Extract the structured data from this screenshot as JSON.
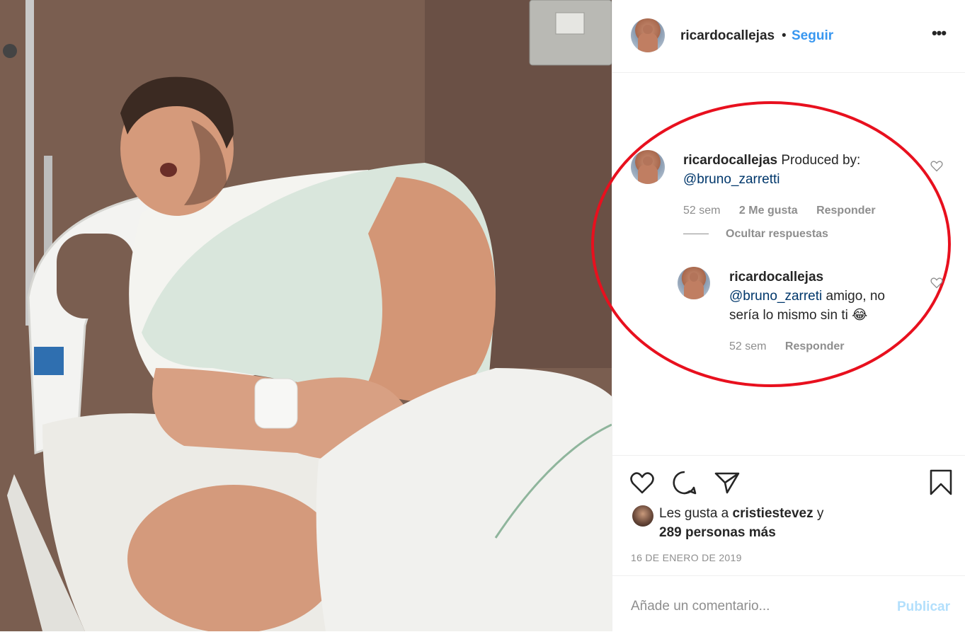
{
  "photo": {
    "subject": "hospital-bed-photo"
  },
  "header": {
    "username": "ricardocallejas",
    "separator": "•",
    "follow_label": "Seguir",
    "more_icon": "more-horizontal-icon"
  },
  "comments": [
    {
      "username": "ricardocallejas",
      "text": "Produced by:",
      "mention": "@bruno_zarretti",
      "time": "52 sem",
      "likes": "2 Me gusta",
      "reply_label": "Responder",
      "hide_replies_label": "Ocultar respuestas"
    }
  ],
  "reply": {
    "username": "ricardocallejas",
    "mention": "@bruno_zarreti",
    "text_part1": " amigo, no",
    "text_part2": "sería lo mismo sin ti",
    "emoji": "😂",
    "time": "52 sem",
    "reply_label": "Responder"
  },
  "likes": {
    "prefix": "Les gusta a",
    "user": "cristiestevez",
    "connector": "y",
    "others": "289 personas más"
  },
  "date": "16 DE ENERO DE 2019",
  "comment_input": {
    "placeholder": "Añade un comentario...",
    "publish_label": "Publicar"
  },
  "colors": {
    "accent": "#3897f0",
    "publish_disabled": "#b2dffc",
    "muted": "#8e8e8e",
    "annotation_red": "#e8101e"
  }
}
